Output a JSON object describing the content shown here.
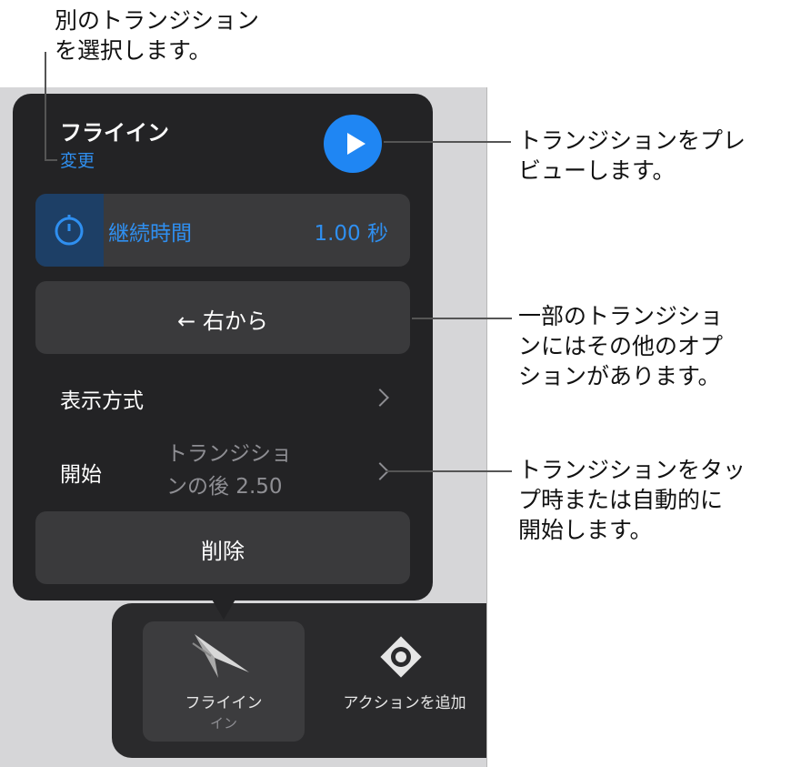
{
  "callouts": {
    "top": "別のトランジション\nを選択します。",
    "preview": "トランジションをプレ\nビューします。",
    "options": "一部のトランジショ\nンにはその他のオプ\nションがあります。",
    "start": "トランジションをタッ\nプ時または自動的に\n開始します。"
  },
  "popover": {
    "title": "フライイン",
    "change_link": "変更",
    "play_icon": "play-icon",
    "duration": {
      "label": "継続時間",
      "value": "1.00 秒",
      "icon": "stopwatch-icon"
    },
    "direction": {
      "label": "← 右から"
    },
    "appearance": {
      "label": "表示方式"
    },
    "start": {
      "label": "開始",
      "value": "トランジショ\nンの後  2.50"
    },
    "delete_label": "削除"
  },
  "toolbar": {
    "fly_label": "フライイン",
    "fly_sub": "イン",
    "action_label": "アクションを追加"
  },
  "colors": {
    "accent": "#2f8ff0",
    "popover_bg": "#232325",
    "button_bg": "#3a3a3c"
  }
}
